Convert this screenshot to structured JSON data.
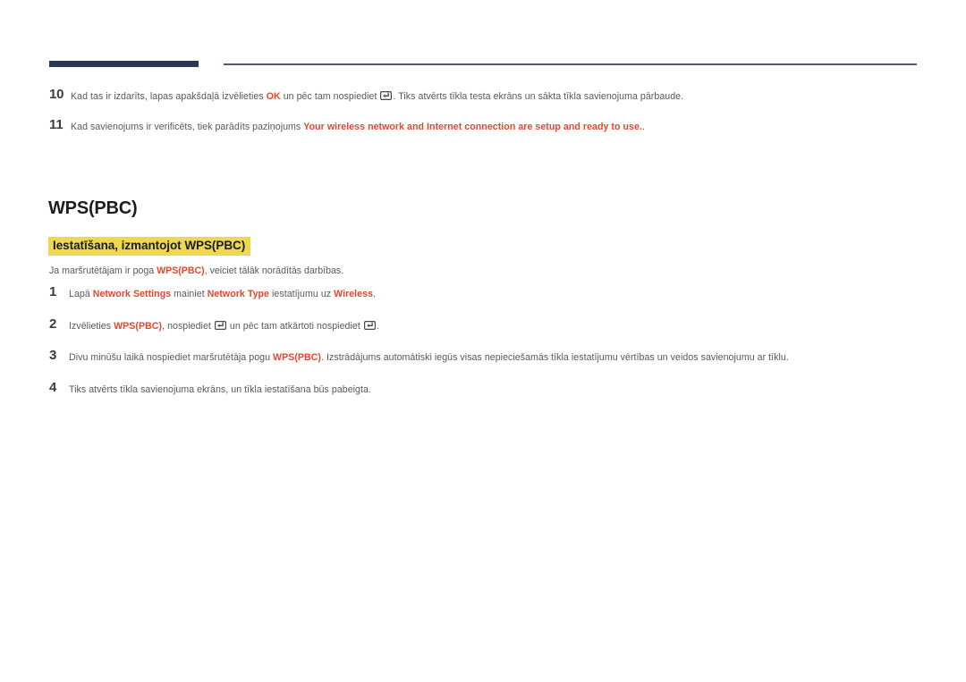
{
  "document": {
    "language": "lv",
    "colors": {
      "accent_red": "#e8452c",
      "highlight_yellow": "#edd84f",
      "rule_navy": "#2c3655",
      "rule_thin": "#56537a",
      "body_text": "#58585a",
      "heading_text": "#1d1d1f"
    }
  },
  "header": {
    "rule_thick_name": "navy-bar",
    "rule_thin_name": "horizontal-rule"
  },
  "top_steps": [
    {
      "number": "10",
      "parts": [
        {
          "text": "Kad tas ir izdarīts, lapas apakšdaļā izvēlieties ",
          "style": "normal"
        },
        {
          "text": "OK",
          "style": "red"
        },
        {
          "text": " un pēc tam nospiediet ",
          "style": "normal"
        },
        {
          "text": "",
          "style": "enter-icon"
        },
        {
          "text": ". Tiks atvērts tīkla testa ekrāns un sākta tīkla savienojuma pārbaude.",
          "style": "normal"
        }
      ]
    },
    {
      "number": "11",
      "parts": [
        {
          "text": "Kad savienojums ir verificēts, tiek parādīts paziņojums ",
          "style": "normal"
        },
        {
          "text": "Your wireless network and Internet connection are setup and ready to use.",
          "style": "red"
        },
        {
          "text": ".",
          "style": "normal"
        }
      ]
    }
  ],
  "section": {
    "title": "WPS(PBC)",
    "subtitle": "Iestatīšana, izmantojot WPS(PBC)",
    "intro_parts": [
      {
        "text": "Ja maršrutētājam ir poga ",
        "style": "normal"
      },
      {
        "text": "WPS(PBC)",
        "style": "red"
      },
      {
        "text": ", veiciet tālāk norādītās darbības.",
        "style": "normal"
      }
    ]
  },
  "wps_steps": [
    {
      "number": "1",
      "parts": [
        {
          "text": "Lapā ",
          "style": "normal"
        },
        {
          "text": "Network Settings",
          "style": "red"
        },
        {
          "text": " mainiet ",
          "style": "normal"
        },
        {
          "text": "Network Type",
          "style": "red"
        },
        {
          "text": " iestatījumu uz ",
          "style": "normal"
        },
        {
          "text": "Wireless",
          "style": "red"
        },
        {
          "text": ".",
          "style": "normal"
        }
      ]
    },
    {
      "number": "2",
      "parts": [
        {
          "text": "Izvēlieties ",
          "style": "normal"
        },
        {
          "text": "WPS(PBC)",
          "style": "red"
        },
        {
          "text": ", nospiediet ",
          "style": "normal"
        },
        {
          "text": "",
          "style": "enter-icon"
        },
        {
          "text": " un pēc tam atkārtoti nospiediet ",
          "style": "normal"
        },
        {
          "text": "",
          "style": "enter-icon"
        },
        {
          "text": ".",
          "style": "normal"
        }
      ]
    },
    {
      "number": "3",
      "parts": [
        {
          "text": "Divu minūšu laikā nospiediet maršrutētāja pogu ",
          "style": "normal"
        },
        {
          "text": "WPS(PBC)",
          "style": "red"
        },
        {
          "text": ". Izstrādājums automātiski iegūs visas nepieciešamās tīkla iestatījumu vērtības un veidos savienojumu ar tīklu.",
          "style": "normal"
        }
      ]
    },
    {
      "number": "4",
      "parts": [
        {
          "text": "Tiks atvērts tīkla savienojuma ekrāns, un tīkla iestatīšana būs pabeigta.",
          "style": "normal"
        }
      ]
    }
  ]
}
